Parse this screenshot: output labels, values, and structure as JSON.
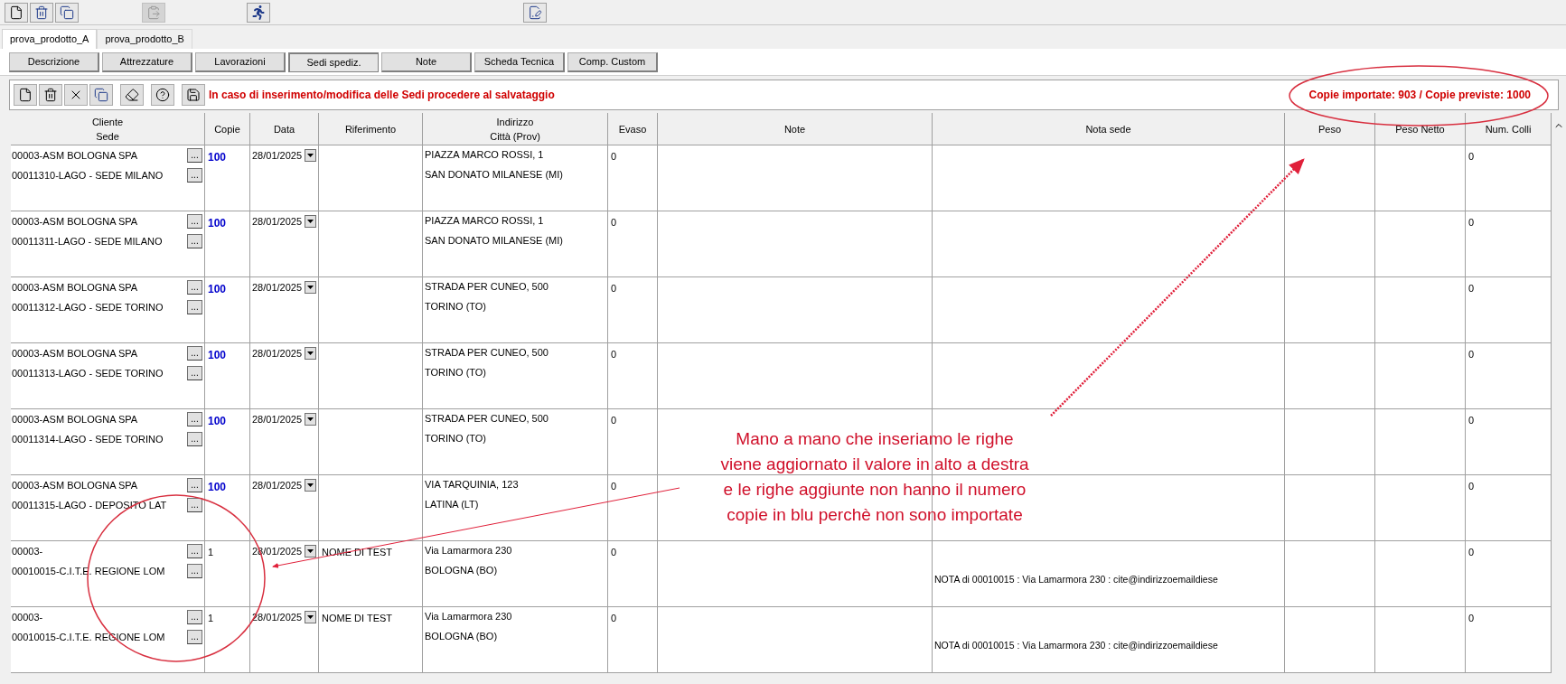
{
  "toolbar": [
    {
      "kind": "new",
      "disabled": false
    },
    {
      "kind": "delete",
      "disabled": false
    },
    {
      "kind": "copy",
      "disabled": false
    },
    {
      "kind": "paste",
      "disabled": true
    },
    {
      "kind": "run",
      "disabled": false
    },
    {
      "kind": "edit",
      "disabled": false
    }
  ],
  "document_tabs": [
    {
      "label": "prova_prodotto_A",
      "selected": true
    },
    {
      "label": "prova_prodotto_B",
      "selected": false
    }
  ],
  "section_buttons": [
    {
      "label": "Descrizione",
      "selected": false
    },
    {
      "label": "Attrezzature",
      "selected": false
    },
    {
      "label": "Lavorazioni",
      "selected": false
    },
    {
      "label": "Sedi spediz.",
      "selected": true
    },
    {
      "label": "Note",
      "selected": false
    },
    {
      "label": "Scheda Tecnica",
      "selected": false
    },
    {
      "label": "Comp. Custom",
      "selected": false
    }
  ],
  "grid_toolbar": {
    "message": "In caso di inserimento/modifica delle Sedi procedere al salvataggio",
    "counter": "Copie importate: 903 / Copie previste: 1000"
  },
  "table": {
    "columns": [
      [
        "Cliente",
        "Sede"
      ],
      [
        "Copie"
      ],
      [
        "Data"
      ],
      [
        "Riferimento"
      ],
      [
        "Indirizzo",
        "Città (Prov)"
      ],
      [
        "Evaso"
      ],
      [
        "Note"
      ],
      [
        "Nota sede"
      ],
      [
        "Peso"
      ],
      [
        "Peso Netto"
      ],
      [
        "Num. Colli"
      ]
    ],
    "browse_button": "...",
    "rows": [
      {
        "cliente": "00003-ASM BOLOGNA SPA",
        "sede": "00011310-LAGO - SEDE MILANO",
        "copie": "100",
        "imported": true,
        "data": "28/01/2025",
        "riferimento": "",
        "indirizzo": "PIAZZA MARCO ROSSI, 1",
        "citta": "SAN DONATO MILANESE (MI)",
        "evaso": "0",
        "nota_sede": "",
        "num_colli": "0"
      },
      {
        "cliente": "00003-ASM BOLOGNA SPA",
        "sede": "00011311-LAGO - SEDE MILANO",
        "copie": "100",
        "imported": true,
        "data": "28/01/2025",
        "riferimento": "",
        "indirizzo": "PIAZZA MARCO ROSSI, 1",
        "citta": "SAN DONATO MILANESE (MI)",
        "evaso": "0",
        "nota_sede": "",
        "num_colli": "0"
      },
      {
        "cliente": "00003-ASM BOLOGNA SPA",
        "sede": "00011312-LAGO - SEDE TORINO",
        "copie": "100",
        "imported": true,
        "data": "28/01/2025",
        "riferimento": "",
        "indirizzo": "STRADA PER CUNEO, 500",
        "citta": "TORINO (TO)",
        "evaso": "0",
        "nota_sede": "",
        "num_colli": "0"
      },
      {
        "cliente": "00003-ASM BOLOGNA SPA",
        "sede": "00011313-LAGO - SEDE TORINO",
        "copie": "100",
        "imported": true,
        "data": "28/01/2025",
        "riferimento": "",
        "indirizzo": "STRADA PER CUNEO, 500",
        "citta": "TORINO (TO)",
        "evaso": "0",
        "nota_sede": "",
        "num_colli": "0"
      },
      {
        "cliente": "00003-ASM BOLOGNA SPA",
        "sede": "00011314-LAGO - SEDE TORINO",
        "copie": "100",
        "imported": true,
        "data": "28/01/2025",
        "riferimento": "",
        "indirizzo": "STRADA PER CUNEO, 500",
        "citta": "TORINO (TO)",
        "evaso": "0",
        "nota_sede": "",
        "num_colli": "0"
      },
      {
        "cliente": "00003-ASM BOLOGNA SPA",
        "sede": "00011315-LAGO - DEPOSITO LAT",
        "copie": "100",
        "imported": true,
        "data": "28/01/2025",
        "riferimento": "",
        "indirizzo": "VIA TARQUINIA, 123",
        "citta": "LATINA (LT)",
        "evaso": "0",
        "nota_sede": "",
        "num_colli": "0"
      },
      {
        "cliente": "00003-",
        "sede": "00010015-C.I.T.E. REGIONE LOM",
        "copie": "1",
        "imported": false,
        "data": "28/01/2025",
        "riferimento": "NOME DI TEST",
        "indirizzo": "Via Lamarmora 230",
        "citta": "BOLOGNA (BO)",
        "evaso": "0",
        "nota_sede": "NOTA di 00010015 : Via Lamarmora 230 : cite@indirizzoemaildiese",
        "num_colli": "0"
      },
      {
        "cliente": "00003-",
        "sede": "00010015-C.I.T.E. REGIONE LOM",
        "copie": "1",
        "imported": false,
        "data": "28/01/2025",
        "riferimento": "NOME DI TEST",
        "indirizzo": "Via Lamarmora 230",
        "citta": "BOLOGNA (BO)",
        "evaso": "0",
        "nota_sede": "NOTA di 00010015 : Via Lamarmora 230 : cite@indirizzoemaildiese",
        "num_colli": "0"
      }
    ]
  },
  "annotation": {
    "lines": [
      "Mano a mano che inseriamo le righe",
      "viene aggiornato il valore in alto a destra",
      "e le righe aggiunte non hanno il numero",
      "copie in blu perchè non sono importate"
    ]
  }
}
